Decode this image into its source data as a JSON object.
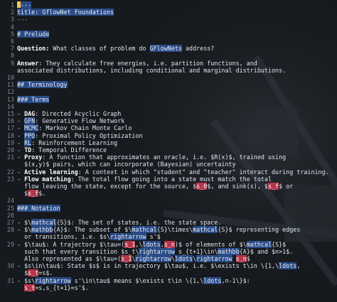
{
  "colors": {
    "background": "#16191d",
    "text": "#dfe6ee",
    "line_numbers": "#7f8a96",
    "highlight_blue": "#2a4b86",
    "highlight_red": "#b3364a",
    "cursor": "#f2c94c"
  },
  "lines": [
    {
      "n": "1",
      "segs": [
        {
          "t": "cursor"
        },
        {
          "t": "h",
          "v": "---"
        }
      ]
    },
    {
      "n": "2",
      "segs": [
        {
          "t": "h",
          "v": "title"
        },
        {
          "t": "h",
          "v": ": "
        },
        {
          "t": "h",
          "v": "GflowNet"
        },
        {
          "t": "h",
          "v": " Foundations"
        }
      ]
    },
    {
      "n": "3",
      "segs": [
        {
          "t": "sep",
          "v": "---"
        }
      ]
    },
    {
      "n": "4",
      "segs": []
    },
    {
      "n": "5",
      "segs": [
        {
          "t": "h",
          "v": "# Prelude"
        }
      ]
    },
    {
      "n": "6",
      "segs": []
    },
    {
      "n": "7",
      "segs": [
        {
          "t": "b",
          "v": "Question:"
        },
        {
          "t": "n",
          "v": " What classes of problem do "
        },
        {
          "t": "h",
          "v": "GFlowNets"
        },
        {
          "t": "n",
          "v": " address?"
        }
      ]
    },
    {
      "n": "8",
      "segs": []
    },
    {
      "n": "9",
      "segs": [
        {
          "t": "b",
          "v": "Answer"
        },
        {
          "t": "n",
          "v": ": They calculate free energies, i.e. partition functions, and"
        }
      ]
    },
    {
      "n": "",
      "segs": [
        {
          "t": "n",
          "v": "associated distributions, including conditional and marginal distributions."
        }
      ]
    },
    {
      "n": "10",
      "segs": []
    },
    {
      "n": "11",
      "segs": [
        {
          "t": "h",
          "v": "## Terminology"
        }
      ]
    },
    {
      "n": "12",
      "segs": []
    },
    {
      "n": "13",
      "segs": [
        {
          "t": "h",
          "v": "### Terms"
        }
      ]
    },
    {
      "n": "14",
      "segs": []
    },
    {
      "n": "15",
      "segs": [
        {
          "t": "n",
          "v": "- "
        },
        {
          "t": "b",
          "v": "DAG"
        },
        {
          "t": "n",
          "v": ": Directed Acyclic Graph"
        }
      ]
    },
    {
      "n": "16",
      "segs": [
        {
          "t": "n",
          "v": "- "
        },
        {
          "t": "h",
          "v": "GFN"
        },
        {
          "t": "n",
          "v": ": Generative Flow Network"
        }
      ]
    },
    {
      "n": "17",
      "segs": [
        {
          "t": "n",
          "v": "- "
        },
        {
          "t": "h",
          "v": "MCMC"
        },
        {
          "t": "n",
          "v": ": Markov Chain Monte Carlo"
        }
      ]
    },
    {
      "n": "18",
      "segs": [
        {
          "t": "n",
          "v": "- "
        },
        {
          "t": "h",
          "v": "PPO"
        },
        {
          "t": "n",
          "v": ": Proximal Policy Optimization"
        }
      ]
    },
    {
      "n": "19",
      "segs": [
        {
          "t": "n",
          "v": "- "
        },
        {
          "t": "h",
          "v": "RL"
        },
        {
          "t": "n",
          "v": ": Reinforcement Learning"
        }
      ]
    },
    {
      "n": "20",
      "segs": [
        {
          "t": "n",
          "v": "- "
        },
        {
          "t": "b",
          "v": "TD"
        },
        {
          "t": "n",
          "v": ": Temporal Difference"
        }
      ]
    },
    {
      "n": "21",
      "segs": [
        {
          "t": "n",
          "v": "- "
        },
        {
          "t": "b",
          "v": "Proxy"
        },
        {
          "t": "n",
          "v": ": A function that approximates an oracle, i.e. $R(x)$, trained using"
        }
      ]
    },
    {
      "n": "",
      "segs": [
        {
          "t": "n",
          "v": "  $(x,y)$ pairs, which can incorporate (Bayesian) uncertainty"
        }
      ]
    },
    {
      "n": "22",
      "segs": [
        {
          "t": "n",
          "v": "- "
        },
        {
          "t": "b",
          "v": "Active learning"
        },
        {
          "t": "n",
          "v": ": A context in which \"student\" and \"teacher\" interact during training."
        }
      ]
    },
    {
      "n": "23",
      "segs": [
        {
          "t": "n",
          "v": "- "
        },
        {
          "t": "b",
          "v": "Flow matching"
        },
        {
          "t": "n",
          "v": ": The total flow going into a state must match the total"
        }
      ]
    },
    {
      "n": "",
      "segs": [
        {
          "t": "n",
          "v": "  flow leaving the state, except for the source, $"
        },
        {
          "t": "r",
          "v": "s_0"
        },
        {
          "t": "n",
          "v": "$, and sink(s), $"
        },
        {
          "t": "r",
          "v": "s_f"
        },
        {
          "t": "n",
          "v": "$ or"
        }
      ]
    },
    {
      "n": "",
      "segs": [
        {
          "t": "n",
          "v": "  $"
        },
        {
          "t": "r",
          "v": "s_f"
        },
        {
          "t": "n",
          "v": "$."
        }
      ]
    },
    {
      "n": "24",
      "segs": []
    },
    {
      "n": "25",
      "segs": [
        {
          "t": "h",
          "v": "### Notation"
        }
      ]
    },
    {
      "n": "26",
      "segs": []
    },
    {
      "n": "27",
      "segs": [
        {
          "t": "n",
          "v": "- $\\"
        },
        {
          "t": "h",
          "v": "mathcal"
        },
        {
          "t": "n",
          "v": "{S}$: The set of states, i.e. the state space."
        }
      ]
    },
    {
      "n": "28",
      "segs": [
        {
          "t": "n",
          "v": "- $\\"
        },
        {
          "t": "h",
          "v": "mathbb"
        },
        {
          "t": "n",
          "v": "{A}$: The subset of $\\"
        },
        {
          "t": "h",
          "v": "mathcal"
        },
        {
          "t": "n",
          "v": "{S}\\times\\"
        },
        {
          "t": "h",
          "v": "mathcal"
        },
        {
          "t": "n",
          "v": "{S}$ representing edges"
        }
      ]
    },
    {
      "n": "",
      "segs": [
        {
          "t": "n",
          "v": "  or transitions, i.e. $s\\"
        },
        {
          "t": "h",
          "v": "rightarrow"
        },
        {
          "t": "n",
          "v": " s'$"
        }
      ]
    },
    {
      "n": "29",
      "segs": [
        {
          "t": "n",
          "v": "- $\\tau$: A trajectory $\\tau=("
        },
        {
          "t": "r",
          "v": "s_1"
        },
        {
          "t": "n",
          "v": ",\\"
        },
        {
          "t": "h",
          "v": "ldots"
        },
        {
          "t": "n",
          "v": ","
        },
        {
          "t": "r",
          "v": "s_n"
        },
        {
          "t": "n",
          "v": ")$ of elements of $\\"
        },
        {
          "t": "h",
          "v": "mathcal"
        },
        {
          "t": "n",
          "v": "{S}$"
        }
      ]
    },
    {
      "n": "",
      "segs": [
        {
          "t": "n",
          "v": "  such that every transition $s_t\\"
        },
        {
          "t": "h",
          "v": "rightarrow"
        },
        {
          "t": "n",
          "v": " s_{t+1}\\in\\"
        },
        {
          "t": "h",
          "v": "mathbb"
        },
        {
          "t": "n",
          "v": "{A}$ and $n>1$."
        }
      ]
    },
    {
      "n": "",
      "segs": [
        {
          "t": "n",
          "v": "  Also represented as $\\tau=("
        },
        {
          "t": "r",
          "v": "s_1"
        },
        {
          "t": "n",
          "v": "\\"
        },
        {
          "t": "h",
          "v": "rightarrow"
        },
        {
          "t": "n",
          "v": "\\"
        },
        {
          "t": "h",
          "v": "ldots"
        },
        {
          "t": "n",
          "v": "\\"
        },
        {
          "t": "h",
          "v": "rightarrow"
        },
        {
          "t": "n",
          "v": " "
        },
        {
          "t": "r",
          "v": "s_n"
        },
        {
          "t": "n",
          "v": "$"
        }
      ]
    },
    {
      "n": "30",
      "segs": [
        {
          "t": "n",
          "v": "- $s\\in\\tau$: State $s$ is in trajectory $\\tau$, i.e. $\\exists t\\in \\{1,\\"
        },
        {
          "t": "h",
          "v": "ldots"
        },
        {
          "t": "n",
          "v": ","
        }
      ]
    },
    {
      "n": "",
      "segs": [
        {
          "t": "n",
          "v": "  $"
        },
        {
          "t": "r",
          "v": "s_t"
        },
        {
          "t": "n",
          "v": "=s$."
        }
      ]
    },
    {
      "n": "31",
      "segs": [
        {
          "t": "n",
          "v": "- $s\\"
        },
        {
          "t": "h",
          "v": "rightarrow"
        },
        {
          "t": "n",
          "v": " s'\\in\\tau$ means $\\exists t\\in \\{1,\\"
        },
        {
          "t": "h",
          "v": "ldots"
        },
        {
          "t": "n",
          "v": ",n-1\\}$:"
        }
      ]
    },
    {
      "n": "",
      "segs": [
        {
          "t": "n",
          "v": "  "
        },
        {
          "t": "r",
          "v": "s_t"
        },
        {
          "t": "n",
          "v": "=s,s_{t+1}=s'$."
        }
      ]
    }
  ]
}
